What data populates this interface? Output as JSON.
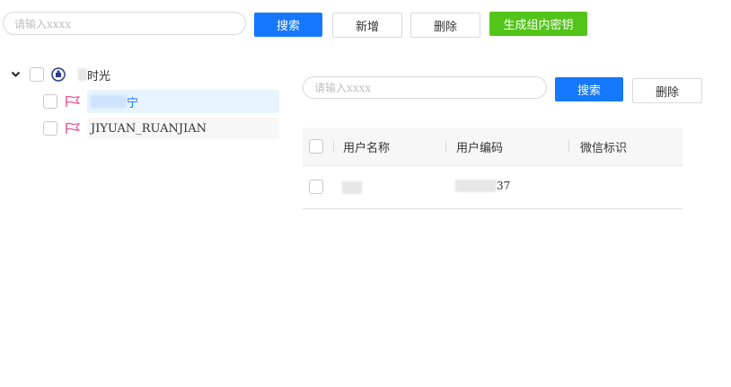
{
  "toolbar": {
    "search_placeholder": "请输入xxxx",
    "search_label": "搜索",
    "add_label": "新增",
    "delete_label": "删除",
    "gen_key_label": "生成组内密钥"
  },
  "tree": {
    "root": {
      "label": "时光"
    },
    "children": [
      {
        "label": "宁",
        "selected": true
      },
      {
        "label": "JIYUAN_RUANJIAN",
        "selected": false
      }
    ]
  },
  "panel": {
    "search_placeholder": "请输入xxxx",
    "search_label": "搜索",
    "delete_label": "删除"
  },
  "table": {
    "columns": [
      "用户名称",
      "用户编码",
      "微信标识"
    ],
    "rows": [
      {
        "name": "",
        "code": "37",
        "wechat": ""
      }
    ]
  },
  "colors": {
    "primary": "#1677ff",
    "success": "#52c41a",
    "selected_bg": "#e6f4ff",
    "flag": "#e0569a"
  }
}
